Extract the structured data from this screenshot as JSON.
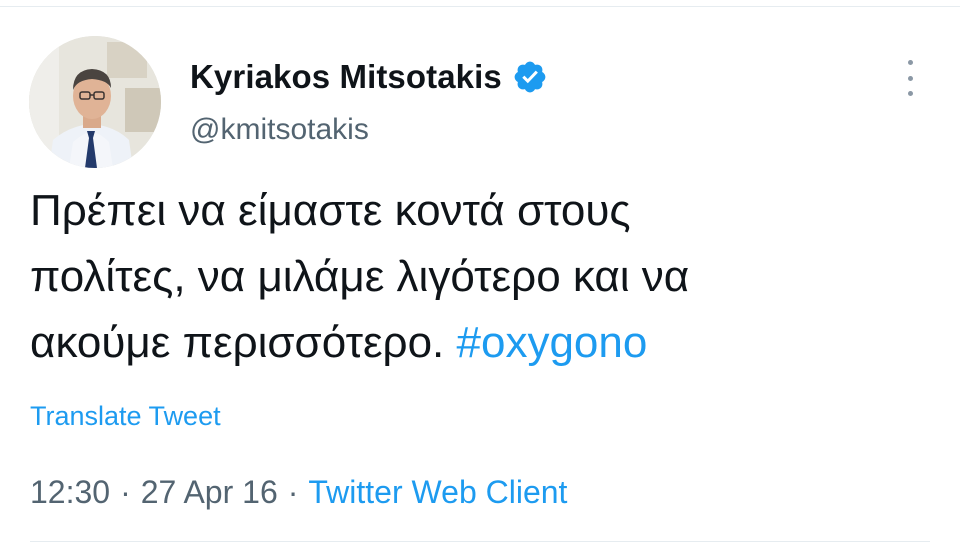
{
  "author": {
    "display_name": "Kyriakos Mitsotakis",
    "handle": "@kmitsotakis",
    "verified": true
  },
  "tweet": {
    "text": "Πρέπει να είμαστε κοντά στους\nπολίτες, να μιλάμε λιγότερο και να\nακούμε περισσότερο. ",
    "hashtag": "#oxygono"
  },
  "translate_label": "Translate Tweet",
  "meta": {
    "time": "12:30",
    "date": "27 Apr 16",
    "separator": "·",
    "source": "Twitter Web Client"
  },
  "colors": {
    "link": "#1d9bf0",
    "secondary_text": "#536471",
    "primary_text": "#0f1419",
    "verified_badge": "#1d9bf0"
  },
  "icons": {
    "verified": "verified-badge-icon",
    "more": "more-vertical-icon"
  }
}
